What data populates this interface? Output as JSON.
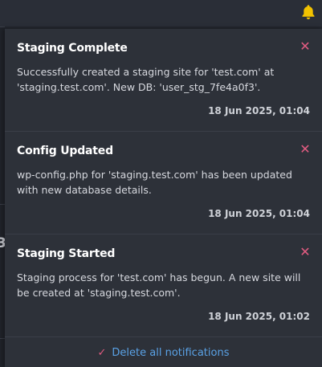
{
  "header": {
    "bell_icon": "bell-icon",
    "bell_color": "#f2c200"
  },
  "notifications": [
    {
      "title": "Staging Complete",
      "message": "Successfully created a staging site for 'test.com' at 'staging.test.com'. New DB: 'user_stg_7fe4a0f3'.",
      "timestamp": "18 Jun 2025, 01:04",
      "close_icon": "close-icon"
    },
    {
      "title": "Config Updated",
      "message": "wp-config.php for 'staging.test.com' has been updated with new database details.",
      "timestamp": "18 Jun 2025, 01:04",
      "close_icon": "close-icon"
    },
    {
      "title": "Staging Started",
      "message": "Staging process for 'test.com' has begun. A new site will be created at 'staging.test.com'.",
      "timestamp": "18 Jun 2025, 01:02",
      "close_icon": "close-icon"
    }
  ],
  "footer": {
    "delete_all_label": "Delete all notifications",
    "check_icon": "check-icon"
  },
  "background": {
    "partial_glyph": "3"
  },
  "colors": {
    "accent_link": "#5aa2e6",
    "close_pink": "#e35c82",
    "bell_yellow": "#f2c200"
  }
}
